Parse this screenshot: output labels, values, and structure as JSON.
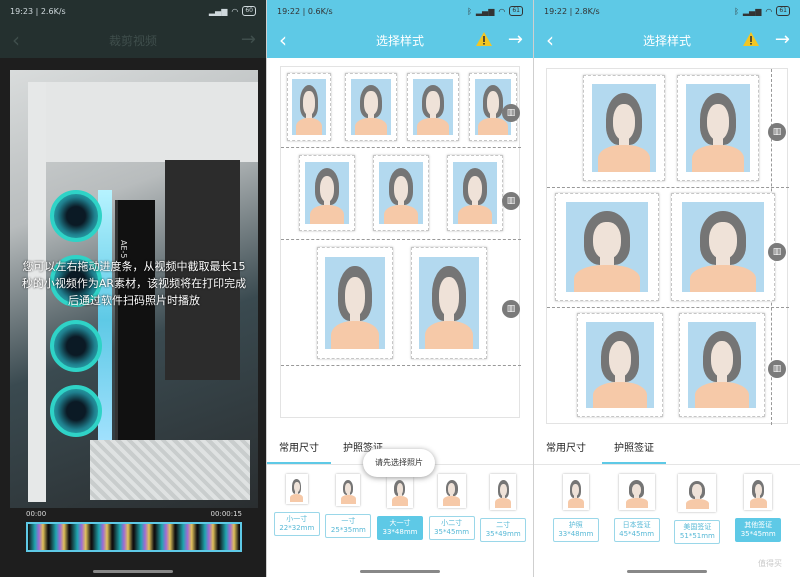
{
  "panel1": {
    "status": {
      "time": "19:23",
      "speed": "2.6K/s",
      "battery": "60"
    },
    "title": "裁剪视频",
    "overlay": "您可以左右拖动进度条，从视频中截取最长15秒的小视频作为AR素材，该视频将在打印完成后通过软件扫码照片时播放",
    "gpu_text": "AE-5",
    "timeline": {
      "start": "00:00",
      "end": "00:00:15"
    }
  },
  "panel2": {
    "status": {
      "time": "19:22",
      "speed": "0.6K/s",
      "battery": "61"
    },
    "title": "选择样式",
    "tabs": [
      "常用尺寸",
      "护照签证"
    ],
    "toast": "请先选择照片",
    "sizes": [
      {
        "name": "小一寸",
        "dims": "22*32mm"
      },
      {
        "name": "一寸",
        "dims": "25*35mm"
      },
      {
        "name": "大一寸",
        "dims": "33*48mm"
      },
      {
        "name": "小二寸",
        "dims": "35*45mm"
      },
      {
        "name": "二寸",
        "dims": "35*49mm"
      }
    ],
    "selected_size": 2
  },
  "panel3": {
    "status": {
      "time": "19:22",
      "speed": "2.8K/s",
      "battery": "61"
    },
    "title": "选择样式",
    "tabs": [
      "常用尺寸",
      "护照签证"
    ],
    "sizes": [
      {
        "name": "护照",
        "dims": "33*48mm"
      },
      {
        "name": "日本签证",
        "dims": "45*45mm"
      },
      {
        "name": "美国签证",
        "dims": "51*51mm"
      },
      {
        "name": "其他签证",
        "dims": "35*45mm"
      }
    ],
    "selected_size": 3,
    "watermark": "值得买"
  },
  "colors": {
    "accent": "#5ec9e6",
    "dark": "#24302f",
    "photo_bg": "#b3d9ef"
  }
}
